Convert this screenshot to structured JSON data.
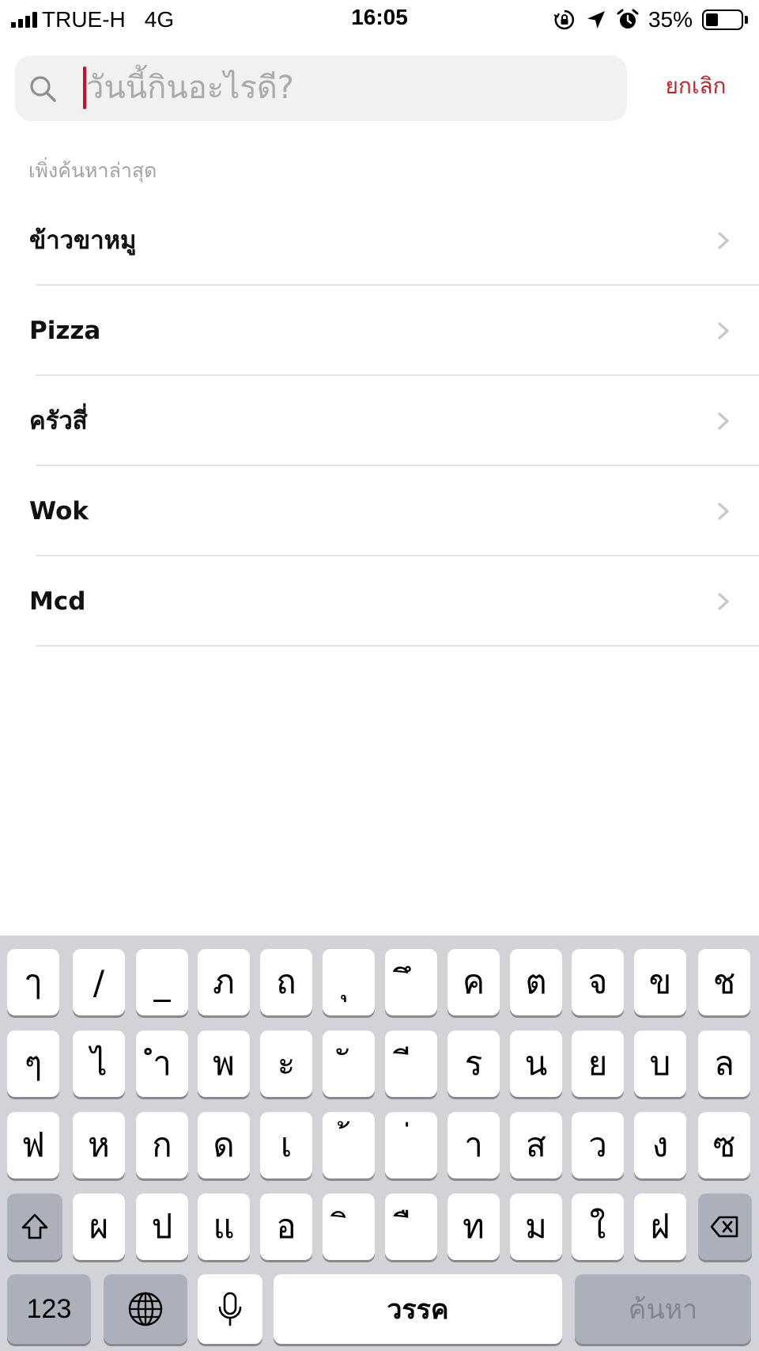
{
  "status_bar": {
    "carrier": "TRUE-H",
    "network": "4G",
    "time": "16:05",
    "battery_percent": "35%",
    "battery_level": 0.35,
    "icons": [
      "signal-bars-icon",
      "orientation-lock-icon",
      "location-arrow-icon",
      "alarm-clock-icon",
      "battery-icon"
    ]
  },
  "search": {
    "placeholder": "วันนี้กินอะไรดี?",
    "value": "",
    "cancel_label": "ยกเลิก",
    "accent_color": "#c0242c"
  },
  "recent": {
    "title": "เพิ่งค้นหาล่าสุด",
    "items": [
      {
        "label": "ข้าวขาหมู"
      },
      {
        "label": "Pizza"
      },
      {
        "label": "ครัวสี่"
      },
      {
        "label": "Wok"
      },
      {
        "label": "Mcd"
      }
    ]
  },
  "keyboard": {
    "row1": [
      "ๅ",
      "/",
      "_",
      "ภ",
      "ถ",
      "ุ",
      "ึ",
      "ค",
      "ต",
      "จ",
      "ข",
      "ช"
    ],
    "row2": [
      "ๆ",
      "ไ",
      "ำ",
      "พ",
      "ะ",
      "ั",
      "ี",
      "ร",
      "น",
      "ย",
      "บ",
      "ล"
    ],
    "row3": [
      "ฟ",
      "ห",
      "ก",
      "ด",
      "เ",
      "้",
      "่",
      "า",
      "ส",
      "ว",
      "ง",
      "ซ"
    ],
    "row4": [
      "ผ",
      "ป",
      "แ",
      "อ",
      "ิ",
      "ื",
      "ท",
      "ม",
      "ใ",
      "ฝ"
    ],
    "numbers_label": "123",
    "space_label": "วรรค",
    "search_label": "ค้นหา",
    "icons": [
      "shift-icon",
      "backspace-icon",
      "globe-icon",
      "microphone-icon"
    ]
  }
}
